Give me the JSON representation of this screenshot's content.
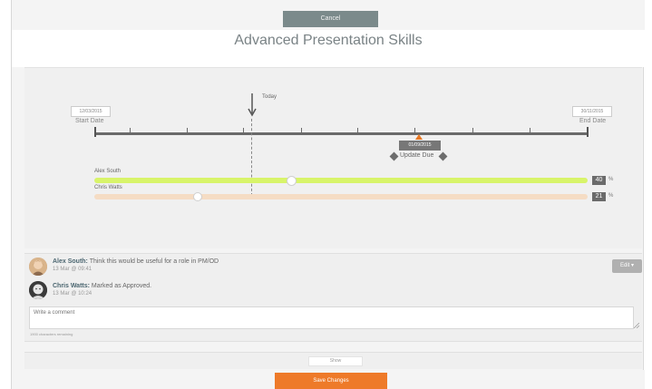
{
  "header": {
    "cancel_label": "Cancel",
    "title": "Advanced Presentation Skills"
  },
  "timeline": {
    "start_date": "12/03/2015",
    "start_caption": "Start Date",
    "end_date": "30/11/2015",
    "end_caption": "End Date",
    "today_label": "Today",
    "update_date": "01/09/2015",
    "update_label": "Update Due",
    "accent_color": "#e87722",
    "people": [
      {
        "name": "Alex South",
        "progress_percent": "40",
        "percent_sign": "%",
        "progress_fraction": 0.4,
        "bar_color": "#d8f46a"
      },
      {
        "name": "Chris Watts",
        "progress_percent": "21",
        "percent_sign": "%",
        "progress_fraction": 0.21,
        "bar_color": "#f5dcc4"
      }
    ]
  },
  "comments": {
    "items": [
      {
        "author": "Alex South:",
        "text": " Think this would be useful for a role in PM/OD",
        "time": "13 Mar @ 09:41"
      },
      {
        "author": "Chris Watts:",
        "text": " Marked as Approved.",
        "time": "13 Mar @ 10:24"
      }
    ],
    "edit_label": "Edit ▾",
    "input_placeholder": "Write a comment",
    "chars_remaining": "1900 characters remaining"
  },
  "footer": {
    "show_label": "Show",
    "save_label": "Save Changes",
    "save_color": "#ee7a29"
  }
}
